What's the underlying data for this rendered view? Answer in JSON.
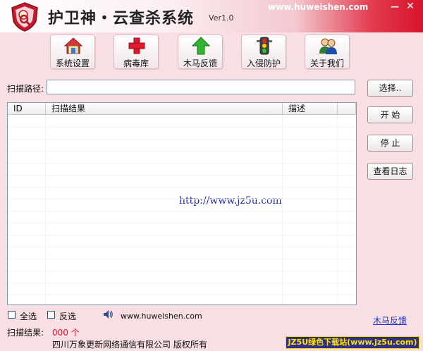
{
  "window": {
    "title": "护卫神・云查杀系统",
    "version": "Ver1.0",
    "site": "www.huweishen.com",
    "min_glyph": "—",
    "close_glyph": "✕"
  },
  "toolbar": [
    {
      "label": "系统设置",
      "icon": "house-icon"
    },
    {
      "label": "病毒库",
      "icon": "red-cross-icon"
    },
    {
      "label": "木马反馈",
      "icon": "green-arrow-up-icon"
    },
    {
      "label": "入侵防护",
      "icon": "traffic-light-icon"
    },
    {
      "label": "关于我们",
      "icon": "users-icon"
    }
  ],
  "scan": {
    "path_label": "扫描路径:",
    "path_value": "",
    "select_button": "选择..",
    "start_button": "开 始",
    "stop_button": "停 止",
    "log_button": "查看日志"
  },
  "list": {
    "columns": [
      "ID",
      "扫描结果",
      "描述",
      ""
    ],
    "rows": [],
    "watermark": "http://www.jz5u.com"
  },
  "footer": {
    "select_all": "全选",
    "invert": "反选",
    "site": "www.huweishen.com",
    "feedback_link": "木马反馈",
    "result_label": "扫描结果:",
    "result_value": "000 个",
    "copyright": "四川万象更新网络通信有限公司 版权所有",
    "badge": "JZ5U绿色下载站(www.jz5u.com)"
  },
  "colors": {
    "background": "#f8dfe3",
    "accent_red": "#d8142c",
    "link": "#1b37c6",
    "result_value": "#e0112b"
  }
}
